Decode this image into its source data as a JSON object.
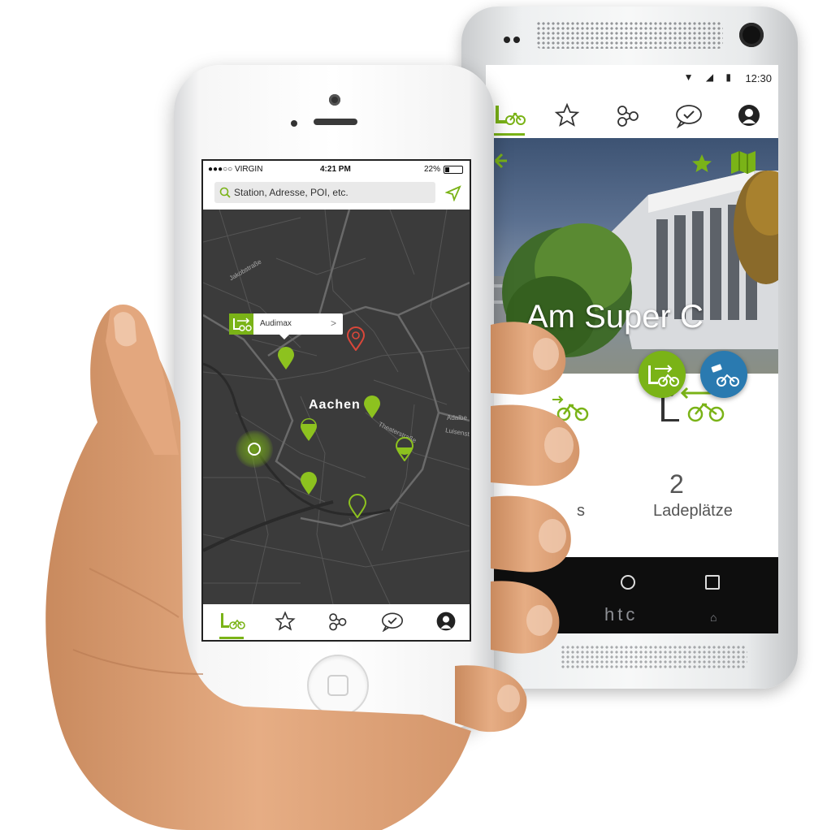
{
  "htc": {
    "status_time": "12:30",
    "brand": "htc",
    "station_title": "Am Super C",
    "slots_count": "2",
    "slots_label": "Ladeplätze",
    "other_label_fragment": "s",
    "accent": "#7ab317",
    "blue": "#2a7ab0"
  },
  "iphone": {
    "carrier": "●●●○○ VIRGIN",
    "time": "4:21 PM",
    "battery": "22%",
    "search_placeholder": "Station, Adresse, POI, etc.",
    "city_label": "Aachen",
    "callout_label": "Audimax",
    "callout_chevron": ">",
    "streets": [
      "Jakobstraße",
      "Theaterstraße",
      "Luisenstr.",
      "Adalbe"
    ],
    "tabs": [
      "map",
      "favorites",
      "share",
      "chat",
      "profile"
    ]
  },
  "icons": {
    "search": "search-icon",
    "locate": "location-arrow-icon",
    "back": "back-arrow-icon",
    "star": "star-icon",
    "map": "map-icon"
  }
}
